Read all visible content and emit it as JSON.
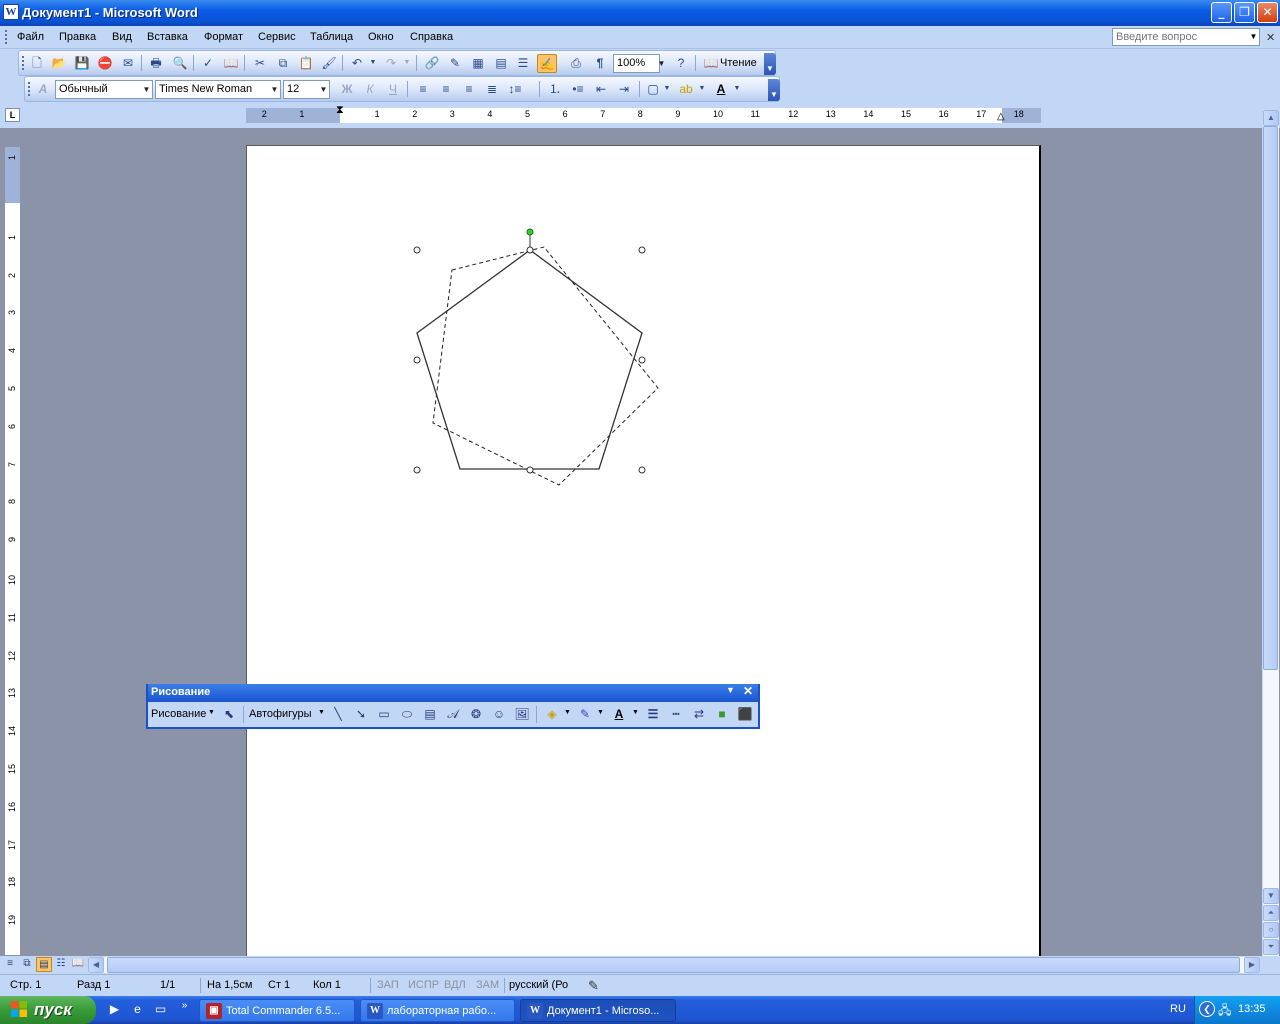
{
  "window": {
    "title": "Документ1 - Microsoft Word"
  },
  "menu": {
    "items": [
      "Файл",
      "Правка",
      "Вид",
      "Вставка",
      "Формат",
      "Сервис",
      "Таблица",
      "Окно",
      "Справка"
    ],
    "ask_placeholder": "Введите вопрос"
  },
  "standard_toolbar": {
    "zoom": "100%",
    "reading_label": "Чтение"
  },
  "format_toolbar": {
    "style": "Обычный",
    "font": "Times New Roman",
    "size": "12"
  },
  "ruler": {
    "h_labels": [
      "2",
      "1",
      "1",
      "2",
      "3",
      "4",
      "5",
      "6",
      "7",
      "8",
      "9",
      "10",
      "11",
      "12",
      "13",
      "14",
      "15",
      "16",
      "17",
      "18"
    ],
    "v_labels": [
      "1",
      "1",
      "2",
      "3",
      "4",
      "5",
      "6",
      "7",
      "8",
      "9",
      "10",
      "11",
      "12",
      "13",
      "14",
      "15",
      "16",
      "17",
      "18",
      "19"
    ]
  },
  "drawing_toolbar": {
    "title": "Рисование",
    "draw_menu": "Рисование",
    "autoshapes": "Автофигуры"
  },
  "status": {
    "page": "Стр. 1",
    "section": "Разд 1",
    "pages": "1/1",
    "at": "На 1,5см",
    "line": "Ст 1",
    "col": "Кол 1",
    "rec": "ЗАП",
    "trk": "ИСПР",
    "ext": "ВДЛ",
    "ovr": "ЗАМ",
    "lang": "русский (Ро"
  },
  "taskbar": {
    "start": "пуск",
    "tasks": [
      {
        "label": "Total Commander 6.5...",
        "active": false
      },
      {
        "label": "лабораторная рабо...",
        "active": false
      },
      {
        "label": "Документ1 - Microso...",
        "active": true
      }
    ],
    "lang": "RU",
    "time": "13:35"
  },
  "icons": {
    "standard": [
      "new-icon",
      "open-icon",
      "save-icon",
      "permission-icon",
      "email-icon",
      "print-icon",
      "print-preview-icon",
      "spelling-icon",
      "research-icon",
      "cut-icon",
      "copy-icon",
      "paste-icon",
      "format-painter-icon",
      "undo-icon",
      "redo-icon",
      "hyperlink-icon",
      "tables-borders-icon",
      "insert-table-icon",
      "insert-excel-icon",
      "columns-icon",
      "drawing-icon",
      "document-map-icon",
      "show-hide-icon",
      "help-icon",
      "read-icon"
    ],
    "drawing": [
      "select-objects-icon",
      "line-icon",
      "arrow-icon",
      "rectangle-icon",
      "oval-icon",
      "text-box-icon",
      "wordart-icon",
      "diagram-icon",
      "clipart-icon",
      "picture-icon",
      "fill-color-icon",
      "line-color-icon",
      "font-color-icon",
      "line-style-icon",
      "dash-style-icon",
      "arrow-style-icon",
      "shadow-icon",
      "3d-icon"
    ]
  }
}
